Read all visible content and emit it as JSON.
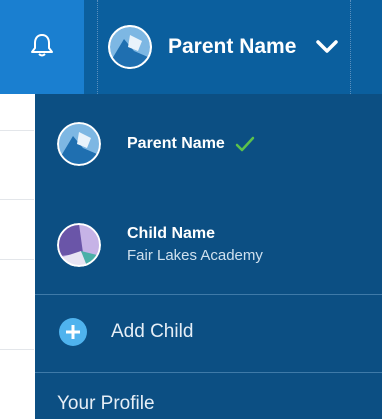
{
  "header": {
    "account_name": "Parent Name"
  },
  "menu": {
    "parent": {
      "name": "Parent Name",
      "selected": true
    },
    "child": {
      "name": "Child Name",
      "school": "Fair Lakes Academy"
    },
    "add_child_label": "Add Child",
    "profile_label": "Your Profile"
  },
  "colors": {
    "header_bg": "#0b5f9e",
    "bell_bg": "#1a7fd0",
    "dropdown_bg": "#0c4f83",
    "check": "#5cc24a",
    "add_icon": "#4fb3ee"
  },
  "icons": {
    "bell": "bell-icon",
    "chevron": "chevron-down-icon",
    "check": "check-icon",
    "add": "plus-circle-icon"
  }
}
